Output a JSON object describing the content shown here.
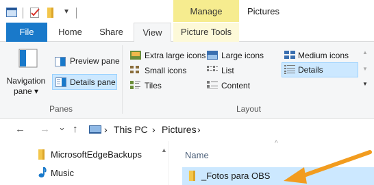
{
  "titlebar": {
    "manage_label": "Manage",
    "window_title": "Pictures",
    "qat_dropdown": "▾",
    "icons": [
      "explorer-app-icon",
      "properties-check-icon",
      "new-folder-icon",
      "customize-qat-icon"
    ]
  },
  "tabs": {
    "file": "File",
    "home": "Home",
    "share": "Share",
    "view": "View",
    "picture_tools": "Picture Tools"
  },
  "ribbon": {
    "panes": {
      "navigation_pane_line1": "Navigation",
      "navigation_pane_line2": "pane ▾",
      "preview_pane": "Preview pane",
      "details_pane": "Details pane",
      "group_label": "Panes"
    },
    "layout": {
      "extra_large_icons": "Extra large icons",
      "large_icons": "Large icons",
      "medium_icons": "Medium icons",
      "small_icons": "Small icons",
      "list": "List",
      "details": "Details",
      "tiles": "Tiles",
      "content": "Content",
      "group_label": "Layout",
      "selected": "Details"
    }
  },
  "address": {
    "back": "←",
    "forward": "→",
    "recent": "⌄",
    "up": "↑",
    "sep": "›",
    "crumbs": [
      "This PC",
      "Pictures"
    ]
  },
  "nav_pane": {
    "items": [
      {
        "label": "MicrosoftEdgeBackups",
        "icon": "folder-icon"
      },
      {
        "label": "Music",
        "icon": "music-note-icon"
      }
    ]
  },
  "file_list": {
    "column_name": "Name",
    "sort_indicator": "^",
    "rows": [
      {
        "name": "_Fotos para OBS",
        "selected": true,
        "icon": "folder-icon"
      }
    ]
  },
  "colors": {
    "accent": "#1979ca",
    "manage_tab": "#f6ec8f",
    "selection": "#cce8ff",
    "annotation_arrow": "#f29c1f"
  }
}
